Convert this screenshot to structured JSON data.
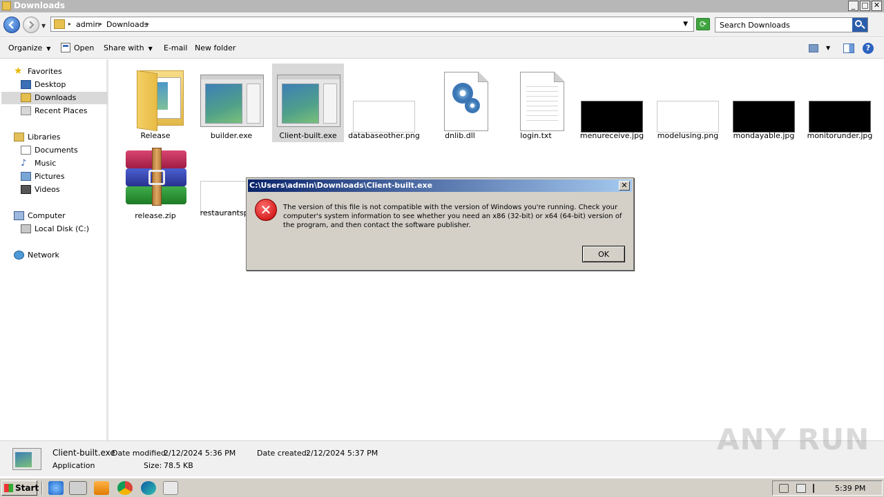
{
  "window": {
    "title": "Downloads",
    "controls": [
      "_",
      "□",
      "✕"
    ]
  },
  "address": {
    "crumbs": [
      "admin",
      "Downloads"
    ],
    "search_placeholder": "Search Downloads"
  },
  "toolbar": {
    "organize": "Organize",
    "open": "Open",
    "share_with": "Share with",
    "email": "E-mail",
    "new_folder": "New folder",
    "help": "?"
  },
  "sidebar": {
    "favorites": {
      "label": "Favorites",
      "items": [
        "Desktop",
        "Downloads",
        "Recent Places"
      ]
    },
    "libraries": {
      "label": "Libraries",
      "items": [
        "Documents",
        "Music",
        "Pictures",
        "Videos"
      ]
    },
    "computer": {
      "label": "Computer",
      "items": [
        "Local Disk (C:)"
      ]
    },
    "network": {
      "label": "Network"
    }
  },
  "files": [
    {
      "name": "Release",
      "type": "folder"
    },
    {
      "name": "builder.exe",
      "type": "exe"
    },
    {
      "name": "Client-built.exe",
      "type": "exe",
      "selected": true
    },
    {
      "name": "databaseother.png",
      "type": "image-white"
    },
    {
      "name": "dnlib.dll",
      "type": "dll"
    },
    {
      "name": "login.txt",
      "type": "txt"
    },
    {
      "name": "menureceive.jpg",
      "type": "image-black"
    },
    {
      "name": "modelusing.png",
      "type": "image-white"
    },
    {
      "name": "mondayable.jpg",
      "type": "image-black"
    },
    {
      "name": "monitorunder.jpg",
      "type": "image-black"
    },
    {
      "name": "release.zip",
      "type": "archive"
    },
    {
      "name": "restaurantspong",
      "type": "image-white"
    }
  ],
  "dialog": {
    "title": "C:\\Users\\admin\\Downloads\\Client-built.exe",
    "message": "The version of this file is not compatible with the version of Windows you're running. Check your computer's system information to see whether you need an x86 (32-bit) or x64 (64-bit) version of the program, and then contact the software publisher.",
    "ok": "OK",
    "close": "✕",
    "error_glyph": "✕"
  },
  "details": {
    "name": "Client-built.exe",
    "kind": "Application",
    "modified_label": "Date modified:",
    "modified_value": "2/12/2024 5:36 PM",
    "size_label": "Size:",
    "size_value": "78.5 KB",
    "created_label": "Date created:",
    "created_value": "2/12/2024 5:37 PM"
  },
  "taskbar": {
    "start": "Start",
    "clock": "5:39 PM"
  },
  "watermark": "ANY RUN",
  "colors": {
    "selection": "#d9d9d9",
    "dialog_title_start": "#0a246a",
    "dialog_title_end": "#a6caf0",
    "error_red": "#c40000"
  }
}
